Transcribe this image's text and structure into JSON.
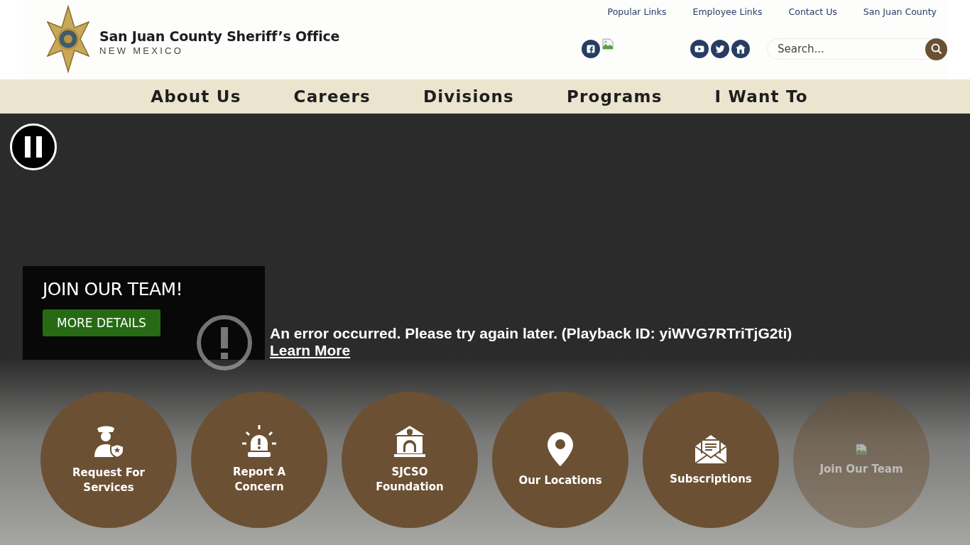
{
  "header": {
    "title": "San Juan County Sheriff’s Office",
    "subtitle": "NEW MEXICO",
    "utility_links": [
      "Popular Links",
      "Employee Links",
      "Contact Us",
      "San Juan County"
    ],
    "social_icons": [
      {
        "kind": "facebook"
      },
      {
        "kind": "broken-image"
      },
      {
        "kind": "youtube"
      },
      {
        "kind": "twitter"
      },
      {
        "kind": "home"
      }
    ],
    "search": {
      "placeholder": "Search..."
    }
  },
  "nav": [
    "About Us",
    "Careers",
    "Divisions",
    "Programs",
    "I Want To"
  ],
  "hero": {
    "card_title": "JOIN OUR TEAM!",
    "card_button": "MORE DETAILS",
    "error_message": "An error occurred. Please try again later. (Playback ID: yiWVG7RTriTjG2ti)",
    "error_link": "Learn More"
  },
  "quick_links": [
    {
      "kind": "officer",
      "label": "Request For Services",
      "dimmed": false
    },
    {
      "kind": "alarm",
      "label": "Report A Concern",
      "dimmed": false
    },
    {
      "kind": "building",
      "label": "SJCSO Foundation",
      "dimmed": false
    },
    {
      "kind": "pin",
      "label": "Our Locations",
      "dimmed": false
    },
    {
      "kind": "envelope",
      "label": "Subscriptions",
      "dimmed": false
    },
    {
      "kind": "broken-image",
      "label": "Join Our Team",
      "dimmed": true
    }
  ]
}
